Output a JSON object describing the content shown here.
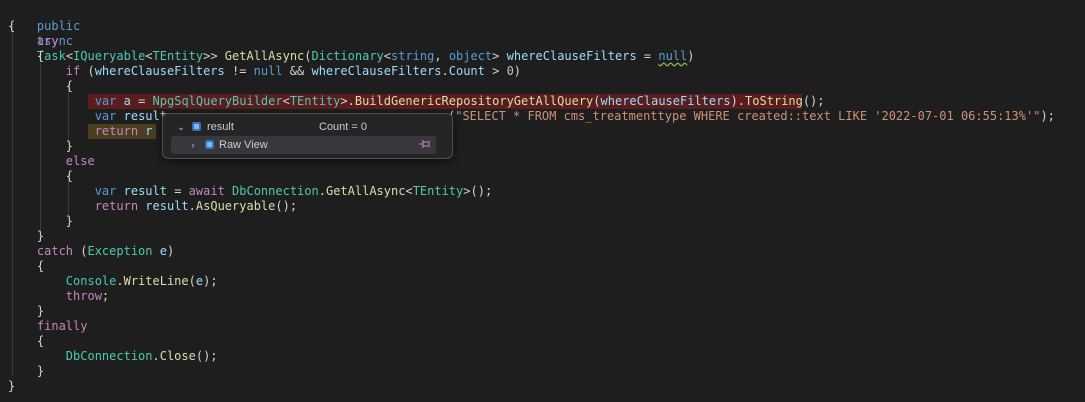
{
  "code": {
    "sig": {
      "public": "public",
      "async": "async",
      "task": "Task",
      "iq": "IQueryable",
      "tentity": "TEntity",
      "method": "GetAllAsync",
      "dict": "Dictionary",
      "string": "string",
      "object": "object",
      "param": "whereClauseFilters",
      "null": "null"
    },
    "kw": {
      "try": "try",
      "if": "if",
      "else": "else",
      "catch": "catch",
      "finally": "finally",
      "var": "var",
      "return": "return",
      "await": "await",
      "null": "null",
      "throw": "throw"
    },
    "ids": {
      "filters": "whereClauseFilters",
      "count": "Count",
      "a": "a",
      "result": "result",
      "builder": "NpgSqlQueryBuilder",
      "tentity": "TEntity",
      "buildMethod": "BuildGenericRepositoryGetAllQuery",
      "toString": "ToString",
      "dbConn": "DbConnection",
      "getAll": "GetAllAsync",
      "asQueryable": "AsQueryable",
      "exception": "Exception",
      "e": "e",
      "console": "Console",
      "writeLine": "WriteLine",
      "close": "Close",
      "r": "r"
    },
    "num0": "0",
    "sqlString": "\"SELECT * FROM cms_treatmenttype WHERE created::text LIKE '2022-07-01 06:55:13%'\""
  },
  "popup": {
    "root_name": "result",
    "root_value": "Count = 0",
    "child_name": "Raw View"
  },
  "colors": {
    "background": "#1e1e1e",
    "keyword": "#569cd6",
    "control": "#c586c0",
    "type": "#4ec9b0",
    "function": "#dcdcaa",
    "variable": "#9cdcfe",
    "string": "#ce9178",
    "number": "#b5cea8",
    "breakpoint_line": "#5a1d1d",
    "current_line": "#4b3e1f"
  },
  "icons": {
    "popup_root": "object-icon",
    "popup_child": "object-icon",
    "pin": "pin-icon"
  }
}
